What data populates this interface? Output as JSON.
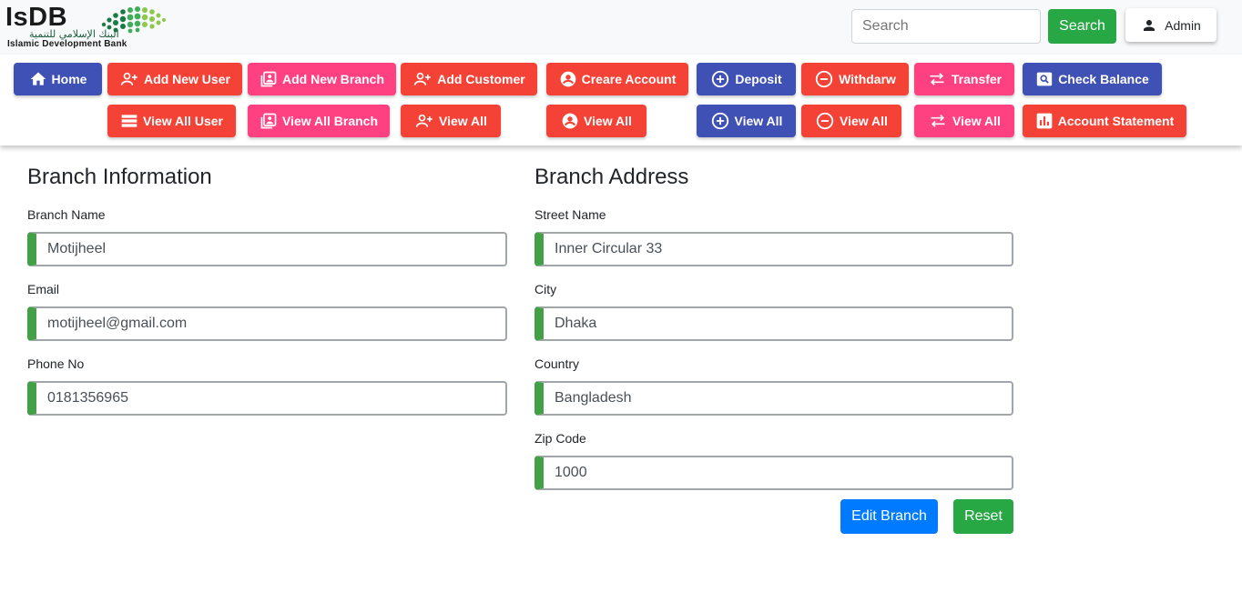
{
  "header": {
    "logo": {
      "wordmark": "IsDB",
      "arabic": "البنك الإسلامي للتنمية",
      "english": "Islamic Development Bank"
    },
    "search": {
      "placeholder": "Search",
      "button_label": "Search"
    },
    "user": {
      "label": "Admin",
      "icon": "person-icon"
    }
  },
  "nav": {
    "row1": [
      {
        "label": "Home",
        "icon": "home-icon",
        "color": "#3f51b5"
      },
      {
        "label": "Add New User",
        "icon": "person-add-icon",
        "color": "#f44336"
      },
      {
        "label": "Add New Branch",
        "icon": "portrait-icon",
        "color": "#ff4081"
      },
      {
        "label": "Add Customer",
        "icon": "person-add-icon",
        "color": "#f44336"
      },
      {
        "label": "Creare Account",
        "icon": "account-circle-icon",
        "color": "#f44336"
      },
      {
        "label": "Deposit",
        "icon": "plus-circle-icon",
        "color": "#3f51b5"
      },
      {
        "label": "Withdarw",
        "icon": "minus-circle-icon",
        "color": "#f44336"
      },
      {
        "label": "Transfer",
        "icon": "swap-arrows-icon",
        "color": "#ff4081"
      },
      {
        "label": "Check Balance",
        "icon": "search-card-icon",
        "color": "#3f51b5"
      }
    ],
    "row2": [
      {
        "label": "View All User",
        "icon": "list-icon",
        "color": "#f44336"
      },
      {
        "label": "View All Branch",
        "icon": "portrait-icon",
        "color": "#ff4081"
      },
      {
        "label": "View All",
        "icon": "person-add-icon",
        "color": "#f44336"
      },
      {
        "label": "View All",
        "icon": "account-circle-icon",
        "color": "#f44336"
      },
      {
        "label": "View All",
        "icon": "plus-circle-icon",
        "color": "#3f51b5"
      },
      {
        "label": "View All",
        "icon": "minus-circle-icon",
        "color": "#f44336"
      },
      {
        "label": "View All",
        "icon": "swap-arrows-icon",
        "color": "#ff4081"
      },
      {
        "label": "Account Statement",
        "icon": "bar-chart-icon",
        "color": "#f44336"
      }
    ]
  },
  "branch_info": {
    "title": "Branch Information",
    "fields": [
      {
        "label": "Branch Name",
        "value": "Motijheel"
      },
      {
        "label": "Email",
        "value": "motijheel@gmail.com"
      },
      {
        "label": "Phone No",
        "value": "0181356965"
      }
    ]
  },
  "branch_address": {
    "title": "Branch Address",
    "fields": [
      {
        "label": "Street Name",
        "value": "Inner Circular 33"
      },
      {
        "label": "City",
        "value": "Dhaka"
      },
      {
        "label": "Country",
        "value": "Bangladesh"
      },
      {
        "label": "Zip Code",
        "value": "1000"
      }
    ]
  },
  "actions": {
    "edit_label": "Edit Branch",
    "reset_label": "Reset"
  },
  "colors": {
    "field_accent": "#43a047",
    "primary": "#007bff",
    "success": "#28a745"
  }
}
